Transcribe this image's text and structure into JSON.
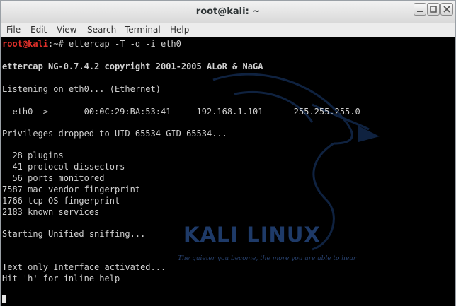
{
  "window": {
    "title": "root@kali: ~"
  },
  "menu": [
    "File",
    "Edit",
    "View",
    "Search",
    "Terminal",
    "Help"
  ],
  "terminal": {
    "prompt_user": "root@kali",
    "prompt_rest": ":~# ettercap -T -q -i eth0",
    "lines": [
      "ettercap NG-0.7.4.2 copyright 2001-2005 ALoR & NaGA",
      "Listening on eth0... (Ethernet)",
      "  eth0 ->       00:0C:29:BA:53:41     192.168.1.101      255.255.255.0",
      "Privileges dropped to UID 65534 GID 65534...",
      "  28 plugins",
      "  41 protocol dissectors",
      "  56 ports monitored",
      "7587 mac vendor fingerprint",
      "1766 tcp OS fingerprint",
      "2183 known services",
      "Starting Unified sniffing...",
      "Text only Interface activated...",
      "Hit 'h' for inline help"
    ]
  },
  "background": {
    "logo_text": "KALI LINUX",
    "tagline": "The quieter you become, the more you are able to hear"
  },
  "colors": {
    "terminal_bg": "#000000",
    "prompt_user": "#e0302a",
    "text": "#d0d0d0",
    "logo": "#1e3a68"
  }
}
